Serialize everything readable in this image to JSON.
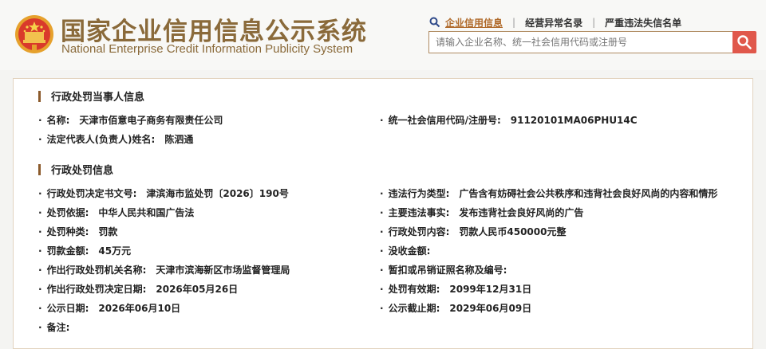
{
  "header": {
    "title_cn": "国家企业信用信息公示系统",
    "title_en": "National Enterprise Credit Information Publicity System",
    "nav": [
      {
        "label": "企业信用信息",
        "active": true
      },
      {
        "label": "经营异常名录",
        "active": false
      },
      {
        "label": "严重违法失信名单",
        "active": false
      }
    ],
    "search_placeholder": "请输入企业名称、统一社会信用代码或注册号"
  },
  "sections": {
    "party": {
      "title": "行政处罚当事人信息",
      "name_label": "名称:",
      "name_value": "天津市佰意电子商务有限责任公司",
      "code_label": "统一社会信用代码/注册号:",
      "code_value": "91120101MA06PHU14C",
      "rep_label": "法定代表人(负责人)姓名:",
      "rep_value": "陈泗通"
    },
    "penalty": {
      "title": "行政处罚信息",
      "left": [
        {
          "label": "行政处罚决定书文号:",
          "value": "津滨海市监处罚〔2026〕190号"
        },
        {
          "label": "处罚依据:",
          "value": "中华人民共和国广告法"
        },
        {
          "label": "处罚种类:",
          "value": "罚款"
        },
        {
          "label": "罚款金额:",
          "value": "45万元"
        },
        {
          "label": "作出行政处罚机关名称:",
          "value": "天津市滨海新区市场监督管理局"
        },
        {
          "label": "作出行政处罚决定日期:",
          "value": "2026年05月26日"
        },
        {
          "label": "公示日期:",
          "value": "2026年06月10日"
        },
        {
          "label": "备注:",
          "value": ""
        }
      ],
      "right": [
        {
          "label": "违法行为类型:",
          "value": "广告含有妨碍社会公共秩序和违背社会良好风尚的内容和情形"
        },
        {
          "label": "主要违法事实:",
          "value": "发布违背社会良好风尚的广告"
        },
        {
          "label": "行政处罚内容:",
          "value": "罚款人民币450000元整"
        },
        {
          "label": "没收金额:",
          "value": ""
        },
        {
          "label": "暂扣或吊销证照名称及编号:",
          "value": ""
        },
        {
          "label": "处罚有效期:",
          "value": "2099年12月31日"
        },
        {
          "label": "公示截止期:",
          "value": "2029年06月09日"
        }
      ]
    }
  },
  "colors": {
    "brand": "#8a6a3a",
    "accent_link": "#b06a2a",
    "search_button": "#e0584b",
    "section_bar": "#8b5a2b"
  }
}
